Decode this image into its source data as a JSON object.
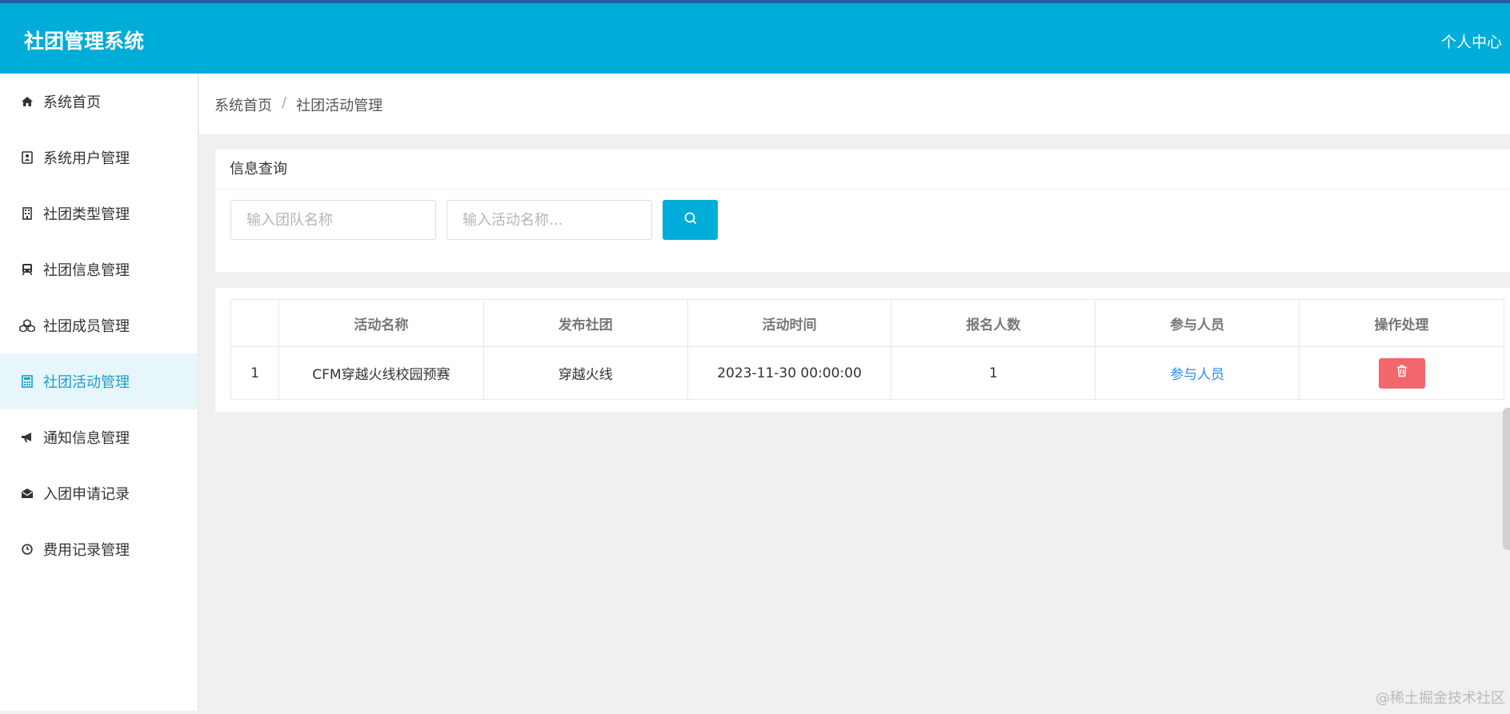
{
  "app": {
    "title": "社团管理系统",
    "user_center": "个人中心"
  },
  "sidebar": {
    "items": [
      {
        "label": "系统首页",
        "icon": "home-icon"
      },
      {
        "label": "系统用户管理",
        "icon": "contact-card-icon"
      },
      {
        "label": "社团类型管理",
        "icon": "building-icon"
      },
      {
        "label": "社团信息管理",
        "icon": "train-icon"
      },
      {
        "label": "社团成员管理",
        "icon": "cubes-icon"
      },
      {
        "label": "社团活动管理",
        "icon": "calculator-icon",
        "active": true
      },
      {
        "label": "通知信息管理",
        "icon": "bullhorn-icon"
      },
      {
        "label": "入团申请记录",
        "icon": "envelope-open-icon"
      },
      {
        "label": "费用记录管理",
        "icon": "clock-icon"
      }
    ]
  },
  "breadcrumb": {
    "home": "系统首页",
    "separator": "/",
    "current": "社团活动管理"
  },
  "query": {
    "title": "信息查询",
    "team_placeholder": "输入团队名称",
    "activity_placeholder": "输入活动名称..."
  },
  "table": {
    "headers": [
      "",
      "活动名称",
      "发布社团",
      "活动时间",
      "报名人数",
      "参与人员",
      "操作处理"
    ],
    "rows": [
      {
        "index": "1",
        "name": "CFM穿越火线校园预赛",
        "club": "穿越火线",
        "time": "2023-11-30 00:00:00",
        "count": "1",
        "participants_link": "参与人员"
      }
    ]
  },
  "watermark": "@稀土掘金技术社区",
  "colors": {
    "header": "#00acd8",
    "accent": "#1aa0c6",
    "danger": "#f2676b",
    "link": "#2d8cf0"
  }
}
